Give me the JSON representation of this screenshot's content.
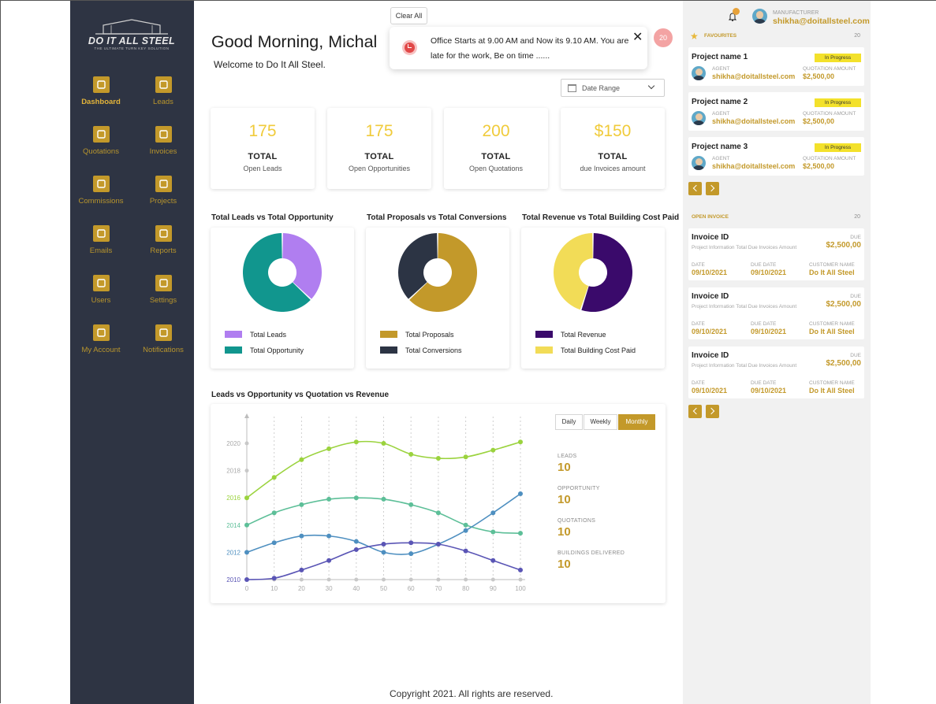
{
  "sidebar": {
    "logo_text": "DO IT ALL STEEL",
    "logo_tagline": "THE ULTIMATE TURN KEY SOLUTION",
    "items": [
      {
        "label": "Dashboard",
        "icon": "grid-icon",
        "active": true
      },
      {
        "label": "Leads",
        "icon": "handshake-icon"
      },
      {
        "label": "Quotations",
        "icon": "document-icon"
      },
      {
        "label": "Invoices",
        "icon": "invoice-icon"
      },
      {
        "label": "Commissions",
        "icon": "percent-icon"
      },
      {
        "label": "Projects",
        "icon": "folder-icon"
      },
      {
        "label": "Emails",
        "icon": "email-icon"
      },
      {
        "label": "Reports",
        "icon": "clipboard-icon"
      },
      {
        "label": "Users",
        "icon": "user-icon"
      },
      {
        "label": "Settings",
        "icon": "gear-icon"
      },
      {
        "label": "My Account",
        "icon": "account-icon"
      },
      {
        "label": "Notifications",
        "icon": "bell-icon"
      }
    ]
  },
  "header": {
    "greeting": "Good Morning, Michal",
    "welcome": "Welcome to Do It All Steel.",
    "clear_all": "Clear All",
    "notification_count": "20",
    "date_range": "Date Range"
  },
  "toast": {
    "message": "Office Starts at 9.00 AM and Now its 9.10 AM. You are late for the work, Be on time ......",
    "close_symbol": "✕"
  },
  "stats": [
    {
      "value": "175",
      "total": "TOTAL",
      "label": "Open Leads"
    },
    {
      "value": "175",
      "total": "TOTAL",
      "label": "Open Opportunities"
    },
    {
      "value": "200",
      "total": "TOTAL",
      "label": "Open Quotations"
    },
    {
      "value": "$150",
      "total": "TOTAL",
      "label": "due Invoices amount"
    }
  ],
  "donuts": [
    {
      "title": "Total Leads vs Total Opportunity",
      "segments": [
        {
          "name": "Total Leads",
          "value": 37,
          "color": "#b07ef0"
        },
        {
          "name": "Total Opportunity",
          "value": 63,
          "color": "#11968e"
        }
      ]
    },
    {
      "title": "Total Proposals vs Total Conversions",
      "segments": [
        {
          "name": "Total Proposals",
          "value": 63,
          "color": "#c3992a"
        },
        {
          "name": "Total Conversions",
          "value": 37,
          "color": "#2c3444"
        }
      ]
    },
    {
      "title": "Total Revenue vs Total Building Cost Paid",
      "segments": [
        {
          "name": "Total Revenue",
          "value": 55,
          "color": "#3a0a6b"
        },
        {
          "name": "Total Building Cost Paid",
          "value": 45,
          "color": "#f2dc57"
        }
      ]
    }
  ],
  "line_chart": {
    "title": "Leads vs Opportunity vs Quotation vs Revenue",
    "periods": [
      "Daily",
      "Weekly",
      "Monthly"
    ],
    "active_period": "Monthly",
    "metrics": [
      {
        "label": "LEADS",
        "value": "10"
      },
      {
        "label": "OPPORTUNITY",
        "value": "10"
      },
      {
        "label": "QUOTATIONS",
        "value": "10"
      },
      {
        "label": "BUILDINGS DELIVERED",
        "value": "10"
      }
    ]
  },
  "chart_data": {
    "type": "line",
    "title": "Leads vs Opportunity vs Quotation vs Revenue",
    "x": [
      0,
      10,
      20,
      30,
      40,
      50,
      60,
      70,
      80,
      90,
      100
    ],
    "xlim": [
      0,
      100
    ],
    "ylim": [
      2010,
      2020
    ],
    "y_ticks": [
      "2010",
      "2012",
      "2014",
      "2016",
      "2018",
      "2020"
    ],
    "y_tick_colors": [
      "#5a55b5",
      "#4e8fc0",
      "#5dbf98",
      "#9bd33e",
      "#a9a9a9",
      "#a9a9a9"
    ],
    "grid": "vertical dotted",
    "series": [
      {
        "color": "#9bd33e",
        "values": [
          2016.0,
          2017.5,
          2018.8,
          2019.6,
          2020.1,
          2020.0,
          2019.2,
          2018.9,
          2019.0,
          2019.5,
          2020.1
        ]
      },
      {
        "color": "#5dbf98",
        "values": [
          2014.0,
          2014.9,
          2015.5,
          2015.9,
          2016.0,
          2015.9,
          2015.5,
          2014.9,
          2014.0,
          2013.5,
          2013.4
        ]
      },
      {
        "color": "#4e8fc0",
        "values": [
          2012.0,
          2012.7,
          2013.2,
          2013.2,
          2012.8,
          2012.0,
          2011.9,
          2012.6,
          2013.6,
          2014.9,
          2016.3
        ]
      },
      {
        "color": "#5a55b5",
        "values": [
          2010.0,
          2010.1,
          2010.7,
          2011.4,
          2012.2,
          2012.6,
          2012.7,
          2012.6,
          2012.1,
          2011.4,
          2010.7
        ]
      }
    ]
  },
  "footer": {
    "copyright": "Copyright 2021. All rights are reserved."
  },
  "right_panel": {
    "role_label": "MANUFACTURER",
    "email": "shikha@doitallsteel.com",
    "favourites": {
      "heading": "FAVOURITES",
      "count": "20",
      "projects": [
        {
          "name": "Project name 1",
          "status": "In Progress",
          "agent_label": "AGENT",
          "agent": "shikha@doitallsteel.com",
          "amount_label": "QUOTATION AMOUNT",
          "amount": "$2,500,00"
        },
        {
          "name": "Project name 2",
          "status": "In Progress",
          "agent_label": "AGENT",
          "agent": "shikha@doitallsteel.com",
          "amount_label": "QUOTATION AMOUNT",
          "amount": "$2,500,00"
        },
        {
          "name": "Project name 3",
          "status": "In Progress",
          "agent_label": "AGENT",
          "agent": "shikha@doitallsteel.com",
          "amount_label": "QUOTATION AMOUNT",
          "amount": "$2,500,00"
        }
      ]
    },
    "invoices": {
      "heading": "OPEN INVOICE",
      "count": "20",
      "items": [
        {
          "id": "Invoice ID",
          "desc": "Project Information Total Due Invoices Amount",
          "due_label": "DUE",
          "due": "$2,500,00",
          "date_label": "DATE",
          "date": "09/10/2021",
          "due_date_label": "DUE DATE",
          "due_date": "09/10/2021",
          "customer_label": "CUSTOMER NAME",
          "customer": "Do It All Steel"
        },
        {
          "id": "Invoice ID",
          "desc": "Project Information Total Due Invoices Amount",
          "due_label": "DUE",
          "due": "$2,500,00",
          "date_label": "DATE",
          "date": "09/10/2021",
          "due_date_label": "DUE DATE",
          "due_date": "09/10/2021",
          "customer_label": "CUSTOMER NAME",
          "customer": "Do It All Steel"
        },
        {
          "id": "Invoice ID",
          "desc": "Project Information Total Due Invoices Amount",
          "due_label": "DUE",
          "due": "$2,500,00",
          "date_label": "DATE",
          "date": "09/10/2021",
          "due_date_label": "DUE DATE",
          "due_date": "09/10/2021",
          "customer_label": "CUSTOMER NAME",
          "customer": "Do It All Steel"
        }
      ]
    }
  }
}
